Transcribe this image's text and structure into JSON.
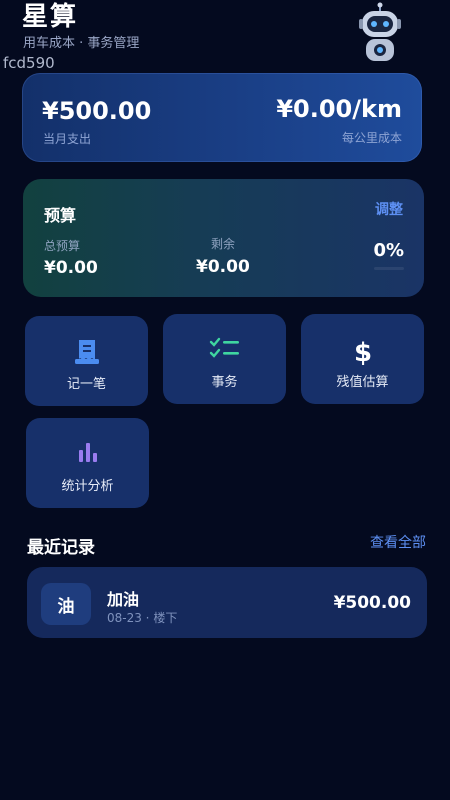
{
  "header": {
    "title": "星算",
    "subtitle": "用车成本 · 事务管理",
    "user_id": "fcd590"
  },
  "cost_summary": {
    "monthly_spend": "¥500.00",
    "monthly_spend_label": "当月支出",
    "per_km_cost": "¥0.00/km",
    "per_km_cost_label": "每公里成本"
  },
  "budget": {
    "title": "预算",
    "adjust_label": "调整",
    "total_label": "总预算",
    "total_value": "¥0.00",
    "remaining_label": "剩余",
    "remaining_value": "¥0.00",
    "percent": "0%",
    "progress": 0
  },
  "quick_actions": [
    {
      "label": "记一笔",
      "icon": "receipt-icon"
    },
    {
      "label": "事务",
      "icon": "checklist-icon"
    },
    {
      "label": "残值估算",
      "icon": "dollar-icon"
    },
    {
      "label": "统计分析",
      "icon": "bar-chart-icon"
    }
  ],
  "recent": {
    "title": "最近记录",
    "view_all_label": "查看全部",
    "records": [
      {
        "avatar": "油",
        "title": "加油",
        "meta": "08-23 · 楼下",
        "amount": "¥500.00"
      }
    ]
  },
  "colors": {
    "background": "#040a1f",
    "accent": "#5d8ff2",
    "tile": "#17306a",
    "check_green": "#3fd6a0",
    "receipt_blue": "#4b8cf0",
    "chart_purple": "#9a7cf0"
  }
}
